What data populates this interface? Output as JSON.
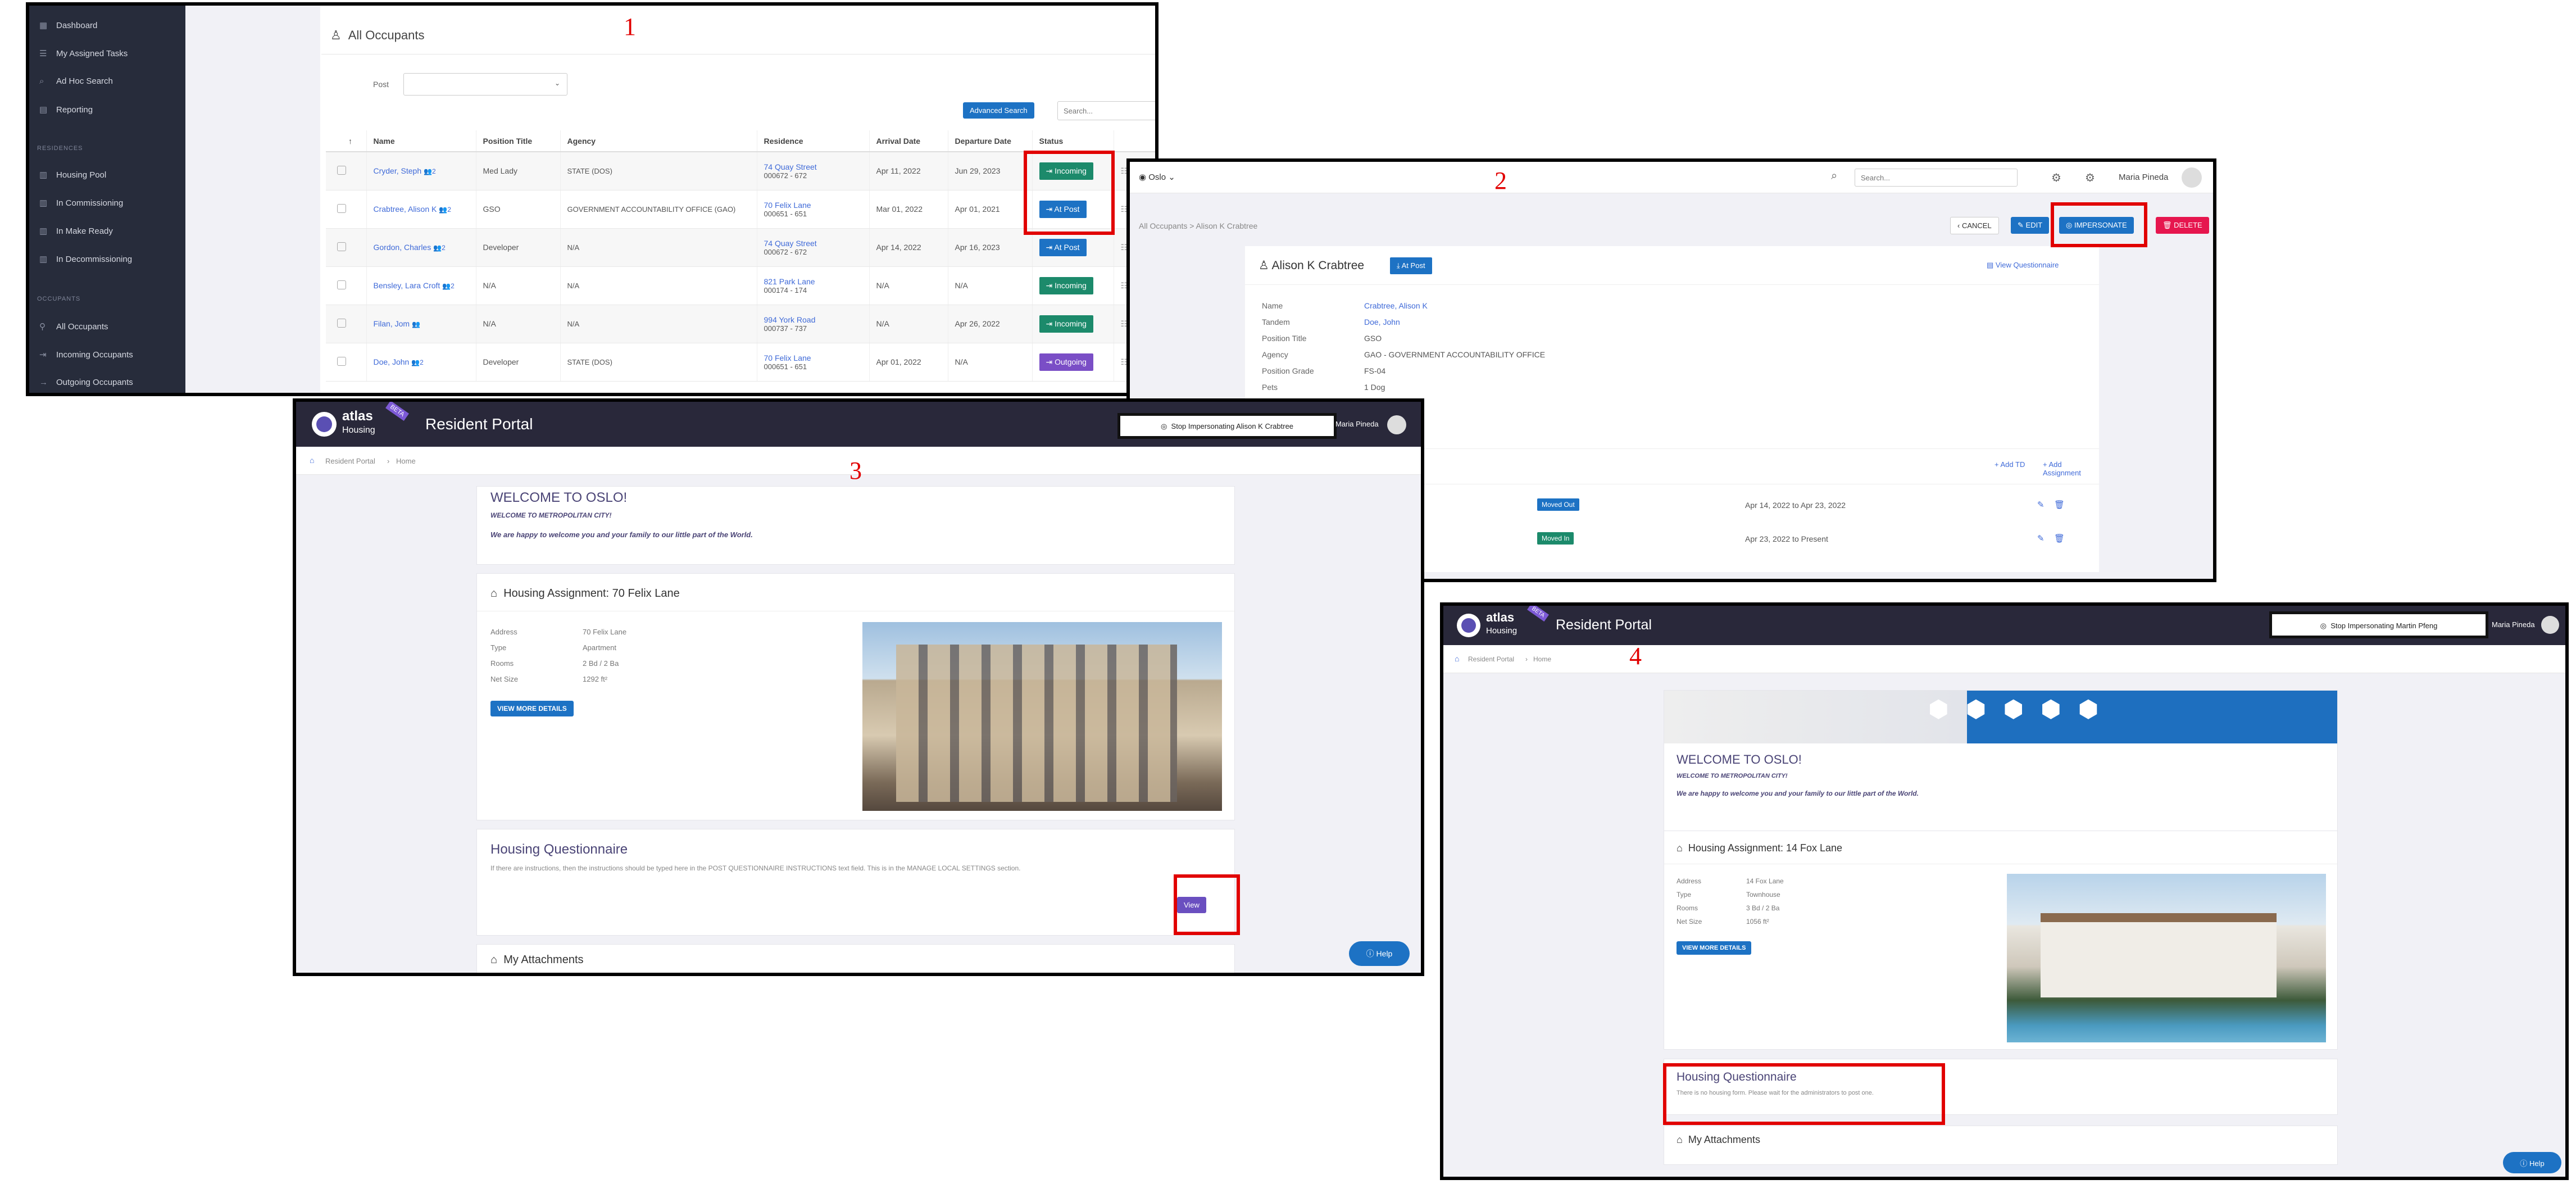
{
  "annotations": {
    "n1": "1",
    "n2": "2",
    "n3": "3",
    "n4": "4"
  },
  "p1": {
    "sidebar": [
      {
        "icon": "dashboard-icon",
        "label": "Dashboard"
      },
      {
        "icon": "tasks-icon",
        "label": "My Assigned Tasks"
      },
      {
        "icon": "search-icon",
        "label": "Ad Hoc Search"
      },
      {
        "icon": "chart-icon",
        "label": "Reporting"
      }
    ],
    "sec_residences": "RESIDENCES",
    "residences": [
      "Housing Pool",
      "In Commissioning",
      "In Make Ready",
      "In Decommissioning"
    ],
    "sec_occupants": "OCCUPANTS",
    "occupants": [
      "All Occupants",
      "Incoming Occupants",
      "Outgoing Occupants"
    ],
    "title": "All Occupants",
    "post_label": "Post",
    "adv_search": "Advanced Search",
    "search_placeholder": "Search...",
    "headers": [
      "Name",
      "Position Title",
      "Agency",
      "Residence",
      "Arrival Date",
      "Departure Date",
      "Status"
    ],
    "rows": [
      {
        "name": "Cryder, Steph",
        "c": "2",
        "title": "Med Lady",
        "agency": "STATE (DOS)",
        "res1": "74 Quay Street",
        "res2": "000672 - 672",
        "arr": "Apr 11, 2022",
        "dep": "Jun 29, 2023",
        "status": "Incoming",
        "kind": "inc"
      },
      {
        "name": "Crabtree, Alison K",
        "c": "2",
        "title": "GSO",
        "agency": "GOVERNMENT ACCOUNTABILITY OFFICE (GAO)",
        "res1": "70 Felix Lane",
        "res2": "000651 - 651",
        "arr": "Mar 01, 2022",
        "dep": "Apr 01, 2021",
        "status": "At Post",
        "kind": "atp"
      },
      {
        "name": "Gordon, Charles",
        "c": "2",
        "title": "Developer",
        "agency": "N/A",
        "res1": "74 Quay Street",
        "res2": "000672 - 672",
        "arr": "Apr 14, 2022",
        "dep": "Apr 16, 2023",
        "status": "At Post",
        "kind": "atp"
      },
      {
        "name": "Bensley, Lara Croft",
        "c": "2",
        "title": "N/A",
        "agency": "N/A",
        "res1": "821 Park Lane",
        "res2": "000174 - 174",
        "arr": "N/A",
        "dep": "N/A",
        "status": "Incoming",
        "kind": "inc"
      },
      {
        "name": "Filan, Jom",
        "c": "",
        "title": "N/A",
        "agency": "N/A",
        "res1": "994 York Road",
        "res2": "000737 - 737",
        "arr": "N/A",
        "dep": "Apr 26, 2022",
        "status": "Incoming",
        "kind": "inc"
      },
      {
        "name": "Doe, John",
        "c": "2",
        "title": "Developer",
        "agency": "STATE (DOS)",
        "res1": "70 Felix Lane",
        "res2": "000651 - 651",
        "arr": "Apr 01, 2022",
        "dep": "N/A",
        "status": "Outgoing",
        "kind": "out"
      }
    ]
  },
  "p2": {
    "location": "Oslo",
    "search_placeholder": "Search...",
    "user": "Maria Pineda",
    "breadcrumb": "All Occupants > Alison K Crabtree",
    "cancel": "CANCEL",
    "edit": "EDIT",
    "impersonate": "IMPERSONATE",
    "delete": "DELETE",
    "name": "Alison K Crabtree",
    "status": "At Post",
    "view_questionnaire": "View Questionnaire",
    "fields": [
      {
        "label": "Name",
        "value": "Crabtree, Alison K",
        "link": true
      },
      {
        "label": "Tandem",
        "value": "Doe, John",
        "link": true
      },
      {
        "label": "Position Title",
        "value": "GSO",
        "link": false
      },
      {
        "label": "Agency",
        "value": "GAO - GOVERNMENT ACCOUNTABILITY OFFICE",
        "link": false
      },
      {
        "label": "Position Grade",
        "value": "FS-04",
        "link": false
      },
      {
        "label": "Pets",
        "value": "1 Dog",
        "link": false
      }
    ],
    "date_fragment": "pr 01, 2021",
    "add_td": "Add TD",
    "add_assignment": "Add Assignment",
    "assignments": [
      {
        "status": "Moved Out",
        "range": "Apr 14, 2022 to Apr 23, 2022",
        "color": "#1d72c4"
      },
      {
        "status": "Moved In",
        "range": "Apr 23, 2022 to Present",
        "color": "#1c8a6b"
      }
    ]
  },
  "p3": {
    "logo1": "atlas",
    "logo2": "Housing",
    "beta": "BETA",
    "portal_title": "Resident Portal",
    "stop_btn": "Stop Impersonating Alison K Crabtree",
    "user": "Maria Pineda",
    "crumb1": "Resident Portal",
    "crumb2": "Home",
    "welcome": "WELCOME TO OSLO!",
    "welcome_sub": "WELCOME TO METROPOLITAN CITY!",
    "welcome_msg": "We are happy to welcome you and your family to our little part of the World.",
    "assign_title": "Housing Assignment: 70 Felix Lane",
    "details": [
      {
        "label": "Address",
        "value": "70 Felix Lane"
      },
      {
        "label": "Type",
        "value": "Apartment"
      },
      {
        "label": "Rooms",
        "value": "2 Bd / 2 Ba"
      },
      {
        "label": "Net Size",
        "value": "1292 ft²"
      }
    ],
    "more_btn": "VIEW MORE DETAILS",
    "q_title": "Housing Questionnaire",
    "q_text": "If there are instructions, then the instructions should be typed here in the POST QUESTIONNAIRE INSTRUCTIONS text field. This is in the MANAGE LOCAL SETTINGS section.",
    "view_btn": "View",
    "attach": "My Attachments",
    "help": "Help"
  },
  "p4": {
    "portal_title": "Resident Portal",
    "stop_btn": "Stop Impersonating Martin Pfeng",
    "user": "Maria Pineda",
    "crumb1": "Resident Portal",
    "crumb2": "Home",
    "welcome": "WELCOME TO OSLO!",
    "welcome_sub": "WELCOME TO METROPOLITAN CITY!",
    "welcome_msg": "We are happy to welcome you and your family to our little part of the World.",
    "assign_title": "Housing Assignment: 14 Fox Lane",
    "details": [
      {
        "label": "Address",
        "value": "14 Fox Lane"
      },
      {
        "label": "Type",
        "value": "Townhouse"
      },
      {
        "label": "Rooms",
        "value": "3 Bd / 2 Ba"
      },
      {
        "label": "Net Size",
        "value": "1056 ft²"
      }
    ],
    "more_btn": "VIEW MORE DETAILS",
    "q_title": "Housing Questionnaire",
    "q_text": "There is no housing form. Please wait for the administrators to post one.",
    "attach": "My Attachments",
    "help": "Help"
  }
}
